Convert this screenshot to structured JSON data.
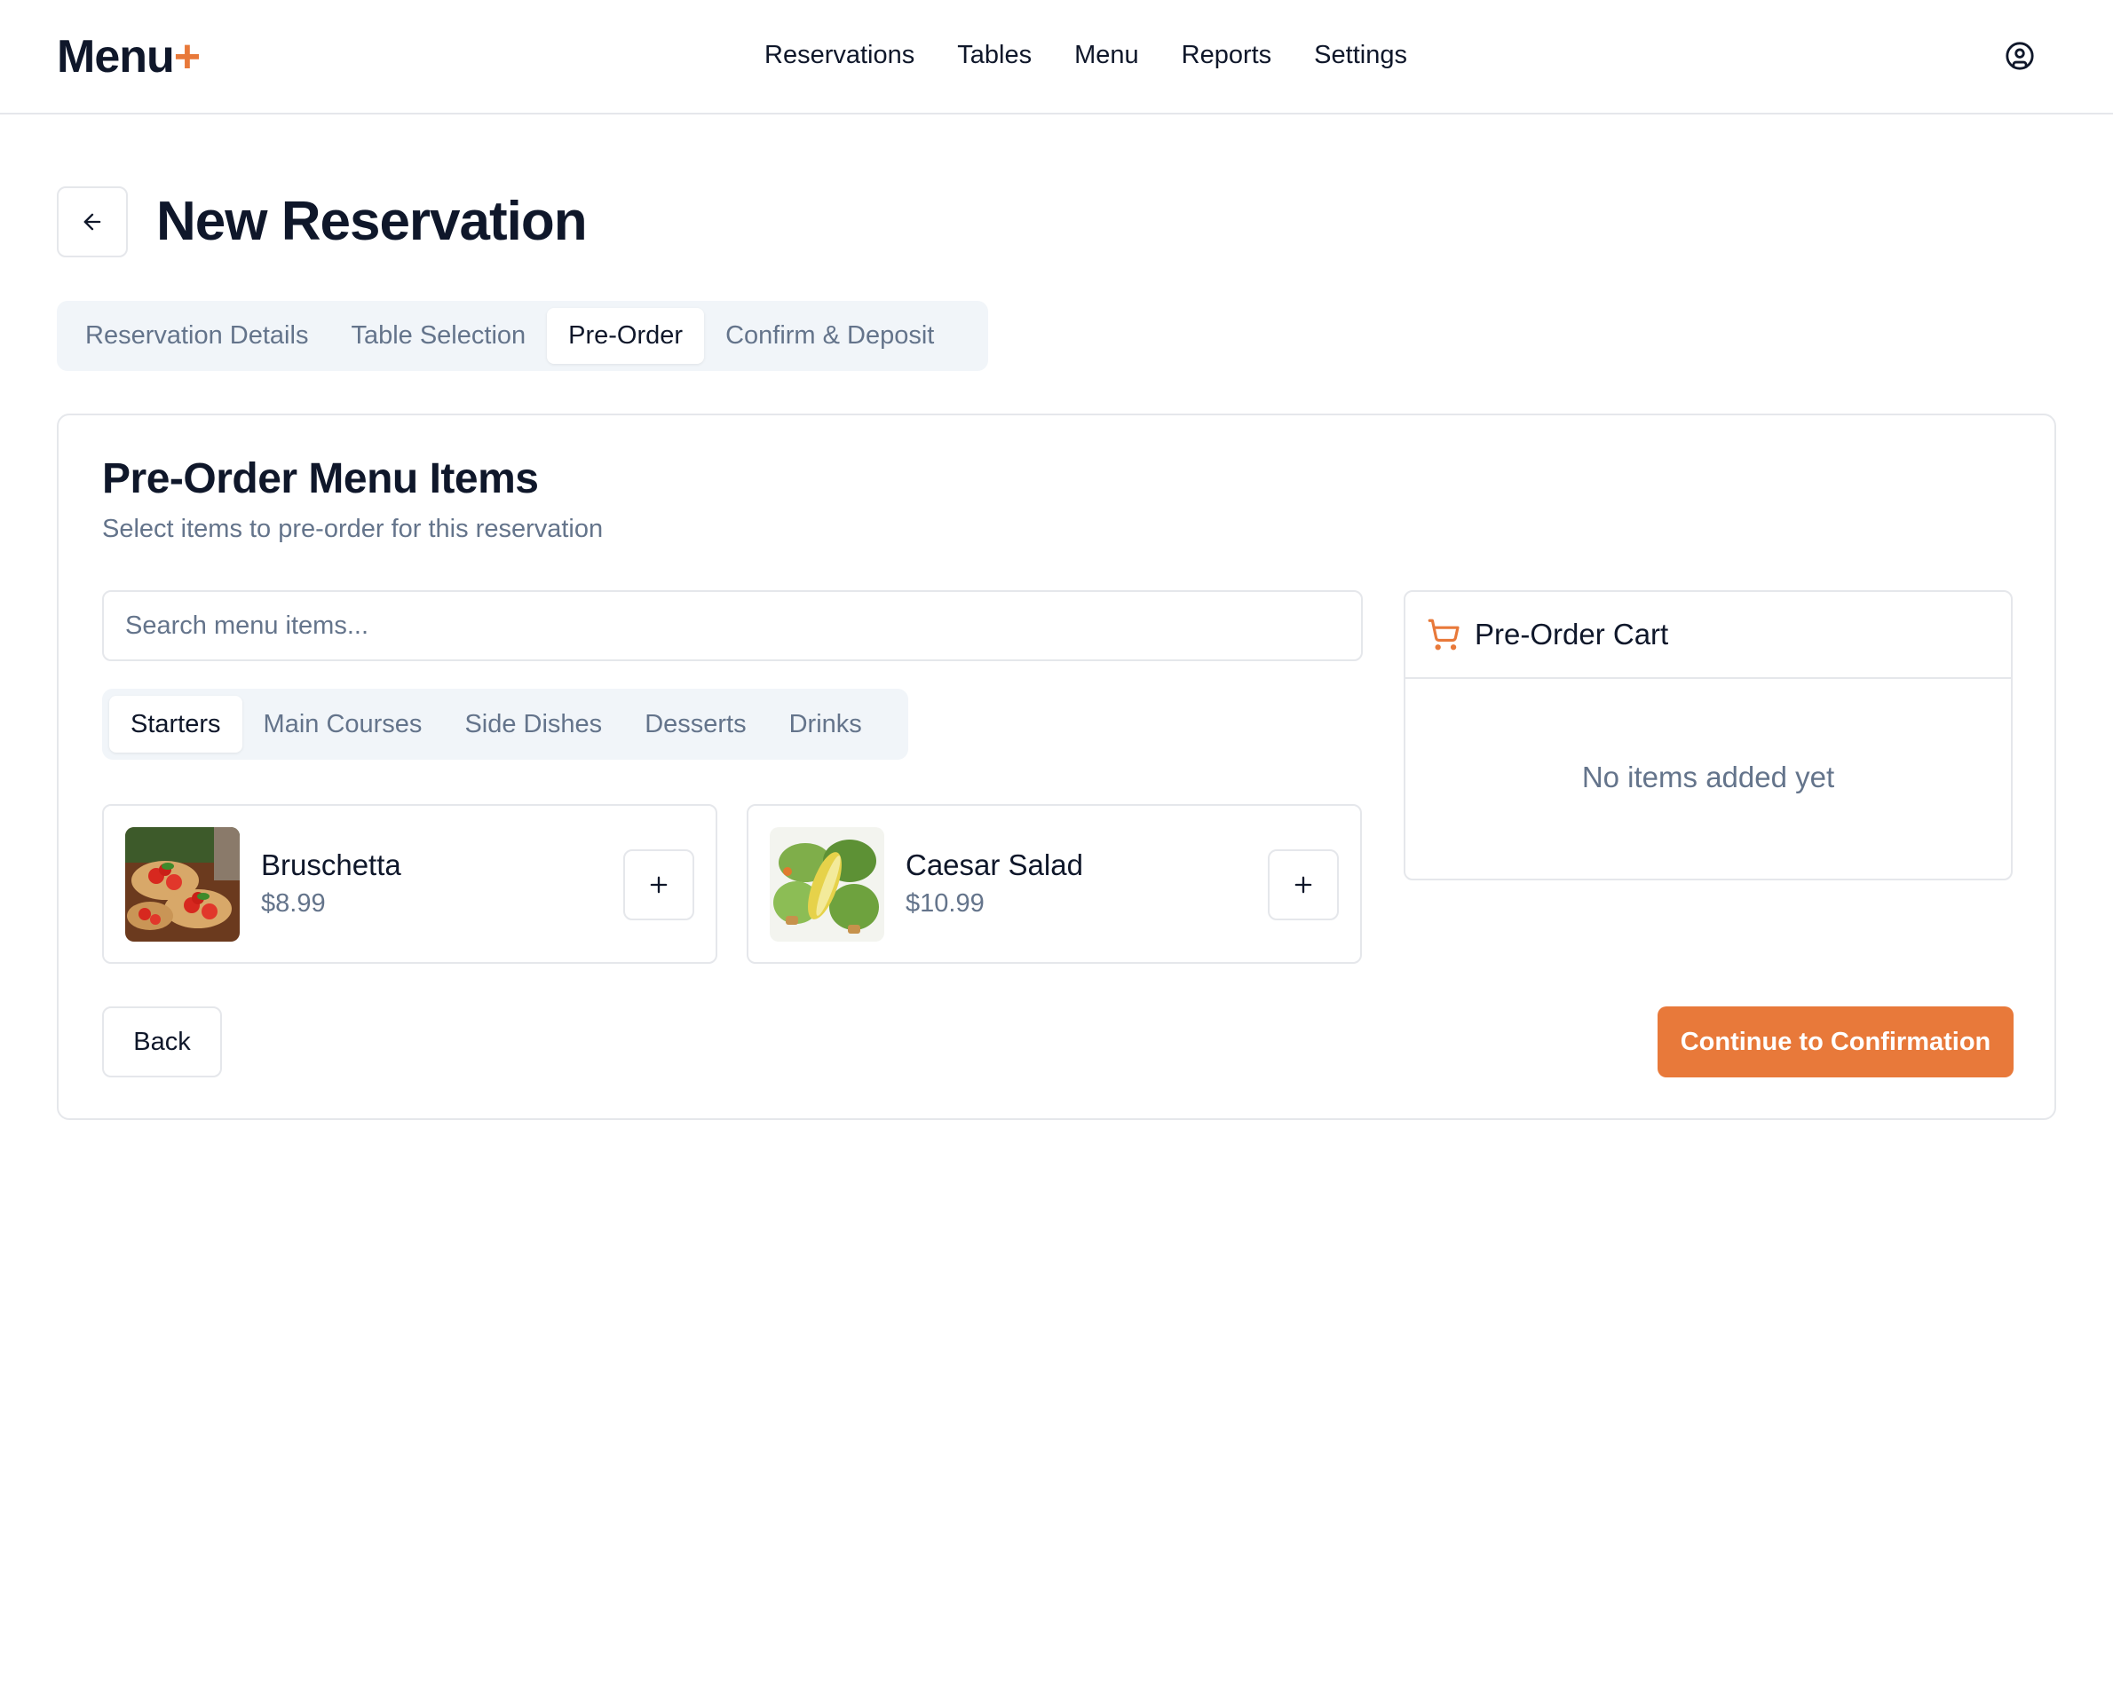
{
  "app": {
    "logo_text": "Menu",
    "logo_accent": "+",
    "accent_color": "#e8793a"
  },
  "nav": {
    "items": [
      "Reservations",
      "Tables",
      "Menu",
      "Reports",
      "Settings"
    ],
    "user_icon": "user-circle-icon"
  },
  "page": {
    "title": "New Reservation",
    "back_icon": "arrow-left-icon"
  },
  "steps": {
    "items": [
      "Reservation Details",
      "Table Selection",
      "Pre-Order",
      "Confirm & Deposit"
    ],
    "active": "Pre-Order"
  },
  "preorder": {
    "title": "Pre-Order Menu Items",
    "subtitle": "Select items to pre-order for this reservation",
    "search_placeholder": "Search menu items...",
    "search_value": "",
    "categories": [
      "Starters",
      "Main Courses",
      "Side Dishes",
      "Desserts",
      "Drinks"
    ],
    "active_category": "Starters",
    "items": [
      {
        "name": "Bruschetta",
        "price": "$8.99",
        "image": "bruschetta-photo",
        "add_icon": "plus-icon"
      },
      {
        "name": "Caesar Salad",
        "price": "$10.99",
        "image": "caesar-salad-photo",
        "add_icon": "plus-icon"
      }
    ]
  },
  "cart": {
    "title": "Pre-Order Cart",
    "icon": "shopping-cart-icon",
    "empty_text": "No items added yet"
  },
  "actions": {
    "back_label": "Back",
    "continue_label": "Continue to Confirmation"
  }
}
